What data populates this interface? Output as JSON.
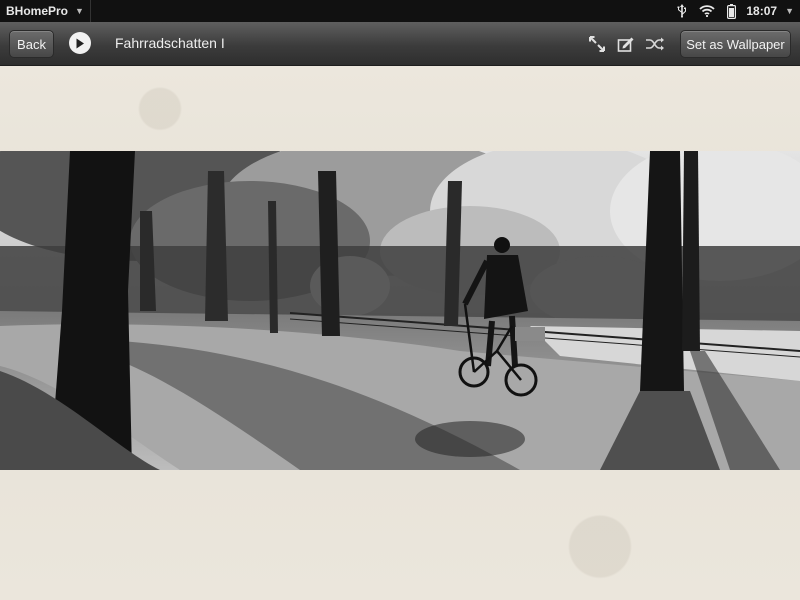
{
  "statusbar": {
    "app_name": "BHomePro",
    "time": "18:07",
    "icons": [
      "usb-icon",
      "wifi-icon",
      "battery-icon"
    ]
  },
  "toolbar": {
    "back_label": "Back",
    "title": "Fahrradschatten I",
    "wallpaper_label": "Set as Wallpaper",
    "icons": [
      "play-icon",
      "fullscreen-icon",
      "edit-icon",
      "shuffle-icon"
    ]
  },
  "colors": {
    "statusbar_bg": "#111111",
    "toolbar_bg": "#3c3c3c",
    "paper_bg": "#ebe6dc"
  },
  "image": {
    "description_icon": "photo-image"
  }
}
